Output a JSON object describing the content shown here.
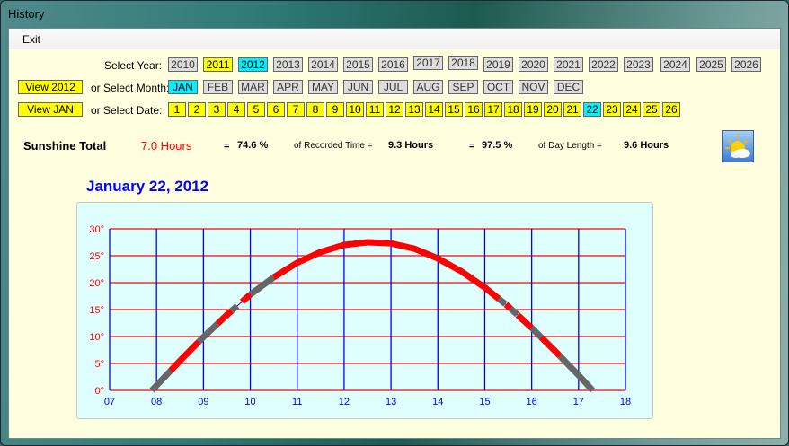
{
  "window": {
    "title": "History"
  },
  "menu": {
    "exit": "Exit"
  },
  "labels": {
    "select_year": "Select Year:",
    "select_month": "or Select Month:",
    "select_date": "or Select Date:"
  },
  "view_year": "View 2012",
  "view_month": "View JAN",
  "years": [
    {
      "label": "2010",
      "state": "normal"
    },
    {
      "label": "2011",
      "state": "yellow"
    },
    {
      "label": "2012",
      "state": "selected"
    },
    {
      "label": "2013",
      "state": "normal"
    },
    {
      "label": "2014",
      "state": "normal"
    },
    {
      "label": "2015",
      "state": "normal"
    },
    {
      "label": "2016",
      "state": "normal"
    },
    {
      "label": "2017",
      "state": "normal"
    },
    {
      "label": "2018",
      "state": "normal"
    },
    {
      "label": "2019",
      "state": "normal"
    },
    {
      "label": "2020",
      "state": "normal"
    },
    {
      "label": "2021",
      "state": "normal"
    },
    {
      "label": "2022",
      "state": "normal"
    },
    {
      "label": "2023",
      "state": "normal"
    },
    {
      "label": "2024",
      "state": "normal"
    },
    {
      "label": "2025",
      "state": "normal"
    },
    {
      "label": "2026",
      "state": "normal"
    }
  ],
  "months": [
    {
      "label": "JAN",
      "state": "selected"
    },
    {
      "label": "FEB",
      "state": "normal"
    },
    {
      "label": "MAR",
      "state": "normal"
    },
    {
      "label": "APR",
      "state": "normal"
    },
    {
      "label": "MAY",
      "state": "normal"
    },
    {
      "label": "JUN",
      "state": "normal"
    },
    {
      "label": "JUL",
      "state": "normal"
    },
    {
      "label": "AUG",
      "state": "normal"
    },
    {
      "label": "SEP",
      "state": "normal"
    },
    {
      "label": "OCT",
      "state": "normal"
    },
    {
      "label": "NOV",
      "state": "normal"
    },
    {
      "label": "DEC",
      "state": "normal"
    }
  ],
  "dates": [
    "1",
    "2",
    "3",
    "4",
    "5",
    "6",
    "7",
    "8",
    "9",
    "10",
    "11",
    "12",
    "13",
    "14",
    "15",
    "16",
    "17",
    "18",
    "19",
    "20",
    "21",
    "22",
    "23",
    "24",
    "25",
    "26"
  ],
  "selected_date": "22",
  "stats": {
    "sunshine_label": "Sunshine Total",
    "sunshine_value": "7.0 Hours",
    "eq1": "=",
    "pct_recorded": "74.6 %",
    "recorded_label": "of Recorded Time =",
    "recorded_value": "9.3 Hours",
    "eq2": "=",
    "pct_day": "97.5 %",
    "day_label": "of Day Length =",
    "day_value": "9.6 Hours"
  },
  "weather_icon": "sun-cloud-icon",
  "date_title": "January 22, 2012",
  "colors": {
    "sunny": "#ff0000",
    "cloudy": "#666666",
    "grid_h": "#ff0000",
    "grid_v": "#0000ff",
    "panel": "#dfffff",
    "accent_selected": "#00f0ff",
    "accent_yellow": "#ffff00"
  },
  "chart_data": {
    "type": "line",
    "xlim": [
      7,
      18
    ],
    "ylim": [
      0,
      30
    ],
    "x_ticks": [
      "07",
      "08",
      "09",
      "10",
      "11",
      "12",
      "13",
      "14",
      "15",
      "16",
      "17",
      "18"
    ],
    "y_ticks": [
      "0°",
      "5°",
      "10°",
      "15°",
      "20°",
      "25°",
      "30°"
    ],
    "grid": true,
    "elevation": {
      "x": [
        7.9,
        8.0,
        8.5,
        9.0,
        9.5,
        10.0,
        10.5,
        11.0,
        11.5,
        12.0,
        12.5,
        13.0,
        13.5,
        14.0,
        14.5,
        15.0,
        15.5,
        16.0,
        16.5,
        17.0,
        17.3
      ],
      "y": [
        0,
        0.9,
        5.5,
        9.9,
        14.0,
        17.8,
        21.0,
        23.7,
        25.7,
        27.0,
        27.5,
        27.3,
        26.3,
        24.5,
        22.1,
        19.1,
        15.6,
        11.6,
        7.3,
        2.8,
        0
      ]
    },
    "segments": [
      {
        "from": 7.9,
        "to": 8.3,
        "sunny": false
      },
      {
        "from": 8.3,
        "to": 8.9,
        "sunny": true
      },
      {
        "from": 8.9,
        "to": 9.3,
        "sunny": false
      },
      {
        "from": 9.3,
        "to": 9.6,
        "sunny": true
      },
      {
        "from": 9.6,
        "to": 9.72,
        "sunny": false
      },
      {
        "from": 9.82,
        "to": 9.9,
        "sunny": true
      },
      {
        "from": 9.9,
        "to": 10.0,
        "sunny": true
      },
      {
        "from": 10.0,
        "to": 10.5,
        "sunny": false
      },
      {
        "from": 10.5,
        "to": 15.3,
        "sunny": true
      },
      {
        "from": 15.3,
        "to": 15.45,
        "sunny": false
      },
      {
        "from": 15.45,
        "to": 15.55,
        "sunny": true
      },
      {
        "from": 15.55,
        "to": 15.7,
        "sunny": false
      },
      {
        "from": 15.7,
        "to": 16.0,
        "sunny": true
      },
      {
        "from": 16.0,
        "to": 16.2,
        "sunny": false
      },
      {
        "from": 16.2,
        "to": 16.6,
        "sunny": true
      },
      {
        "from": 16.6,
        "to": 17.3,
        "sunny": false
      }
    ]
  }
}
